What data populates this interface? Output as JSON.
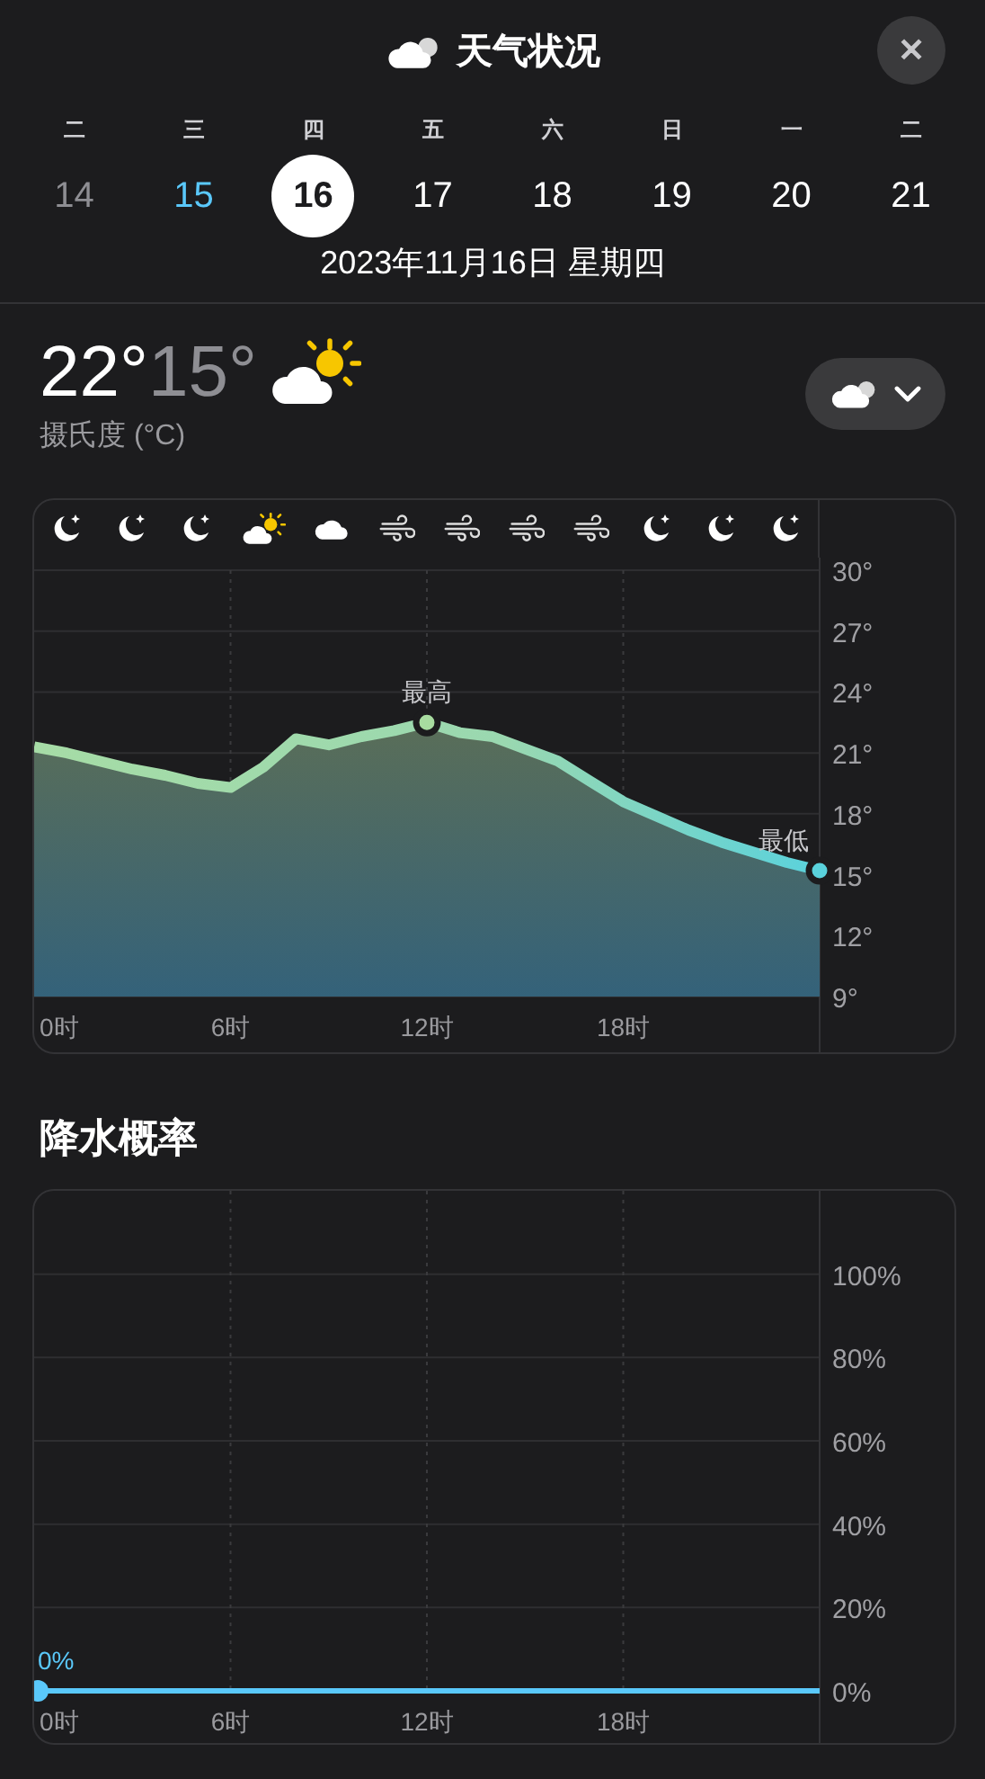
{
  "header": {
    "title": "天气状况",
    "close_label": "✕"
  },
  "days": [
    {
      "weekday": "二",
      "date": "14",
      "kind": "past",
      "selected": false
    },
    {
      "weekday": "三",
      "date": "15",
      "kind": "today",
      "selected": false
    },
    {
      "weekday": "四",
      "date": "16",
      "kind": "future",
      "selected": true
    },
    {
      "weekday": "五",
      "date": "17",
      "kind": "future",
      "selected": false
    },
    {
      "weekday": "六",
      "date": "18",
      "kind": "future",
      "selected": false
    },
    {
      "weekday": "日",
      "date": "19",
      "kind": "future",
      "selected": false
    },
    {
      "weekday": "一",
      "date": "20",
      "kind": "future",
      "selected": false
    },
    {
      "weekday": "二",
      "date": "21",
      "kind": "future",
      "selected": false
    }
  ],
  "full_date": "2023年11月16日 星期四",
  "summary": {
    "high": "22°",
    "low": "15°",
    "unit": "摄氏度 (°C)"
  },
  "hourly_icons": [
    {
      "kind": "moon"
    },
    {
      "kind": "moon"
    },
    {
      "kind": "moon"
    },
    {
      "kind": "sun-cloud"
    },
    {
      "kind": "cloud"
    },
    {
      "kind": "wind"
    },
    {
      "kind": "wind"
    },
    {
      "kind": "wind"
    },
    {
      "kind": "wind"
    },
    {
      "kind": "moon"
    },
    {
      "kind": "moon"
    },
    {
      "kind": "moon"
    }
  ],
  "temperature": {
    "chart_data": {
      "type": "area",
      "grid": true,
      "x": [
        0,
        1,
        2,
        3,
        4,
        5,
        6,
        7,
        8,
        9,
        10,
        11,
        12,
        13,
        14,
        15,
        16,
        17,
        18,
        19,
        20,
        21,
        22,
        23,
        24
      ],
      "series": [
        {
          "color": "#8fd8b0",
          "values": [
            21.3,
            21.0,
            20.6,
            20.2,
            19.9,
            19.5,
            19.3,
            20.3,
            21.7,
            21.4,
            21.8,
            22.1,
            22.5,
            22.0,
            21.8,
            21.2,
            20.6,
            19.6,
            18.6,
            17.9,
            17.2,
            16.6,
            16.1,
            15.6,
            15.2
          ]
        }
      ],
      "xlim": [
        0,
        24
      ],
      "ylim": [
        9,
        30
      ],
      "xticks": [
        {
          "value": 0,
          "label": "0时"
        },
        {
          "value": 6,
          "label": "6时"
        },
        {
          "value": 12,
          "label": "12时"
        },
        {
          "value": 18,
          "label": "18时"
        }
      ],
      "yticks": [
        {
          "value": 30,
          "label": "30°"
        },
        {
          "value": 27,
          "label": "27°"
        },
        {
          "value": 24,
          "label": "24°"
        },
        {
          "value": 21,
          "label": "21°"
        },
        {
          "value": 18,
          "label": "18°"
        },
        {
          "value": 15,
          "label": "15°"
        },
        {
          "value": 12,
          "label": "12°"
        },
        {
          "value": 9,
          "label": "9°"
        }
      ],
      "annotations": [
        {
          "text": "最高"
        },
        {
          "text": "最低"
        }
      ]
    }
  },
  "precipitation": {
    "title": "降水概率",
    "chart_data": {
      "type": "line",
      "grid": true,
      "x": [
        0,
        24
      ],
      "series": [
        {
          "color": "#5ac8fa",
          "values": [
            0,
            0
          ]
        }
      ],
      "xlim": [
        0,
        24
      ],
      "ylim": [
        0,
        120
      ],
      "xticks": [
        {
          "value": 0,
          "label": "0时"
        },
        {
          "value": 6,
          "label": "6时"
        },
        {
          "value": 12,
          "label": "12时"
        },
        {
          "value": 18,
          "label": "18时"
        }
      ],
      "yticks": [
        {
          "value": 100,
          "label": "100%"
        },
        {
          "value": 80,
          "label": "80%"
        },
        {
          "value": 60,
          "label": "60%"
        },
        {
          "value": 40,
          "label": "40%"
        },
        {
          "value": 20,
          "label": "20%"
        },
        {
          "value": 0,
          "label": "0%"
        }
      ],
      "annotations": [
        {
          "text": "0%"
        }
      ]
    }
  }
}
